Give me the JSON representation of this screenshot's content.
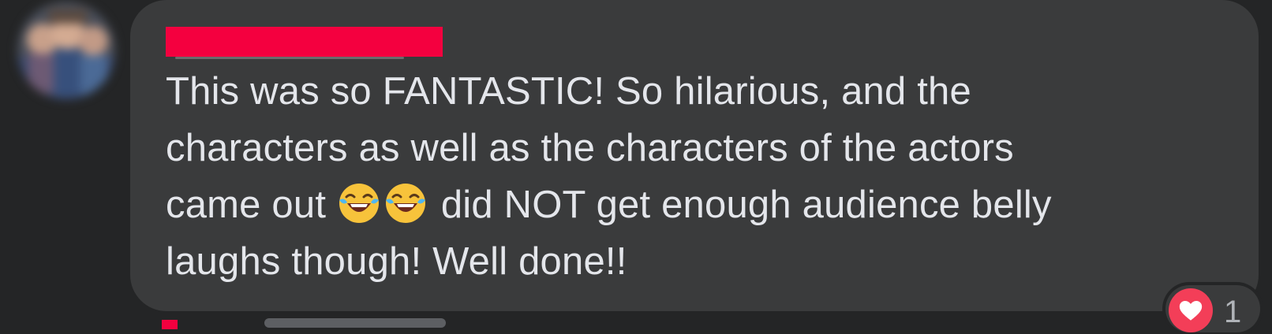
{
  "comment": {
    "author_name_redacted": true,
    "text_lines": [
      "This was so FANTASTIC! So hilarious, and the",
      "characters as well as the characters of the actors",
      "did NOT get enough audience belly",
      "laughs though! Well done!!"
    ],
    "line3_prefix": "came out",
    "emojis": [
      "face-with-tears-of-joy-icon",
      "face-with-tears-of-joy-icon"
    ]
  },
  "reactions": {
    "icon": "heart-icon",
    "count": "1"
  },
  "colors": {
    "background": "#242526",
    "bubble": "#3a3b3c",
    "text": "#e4e6eb",
    "redaction": "#f4003f",
    "heart": "#f33e58"
  }
}
